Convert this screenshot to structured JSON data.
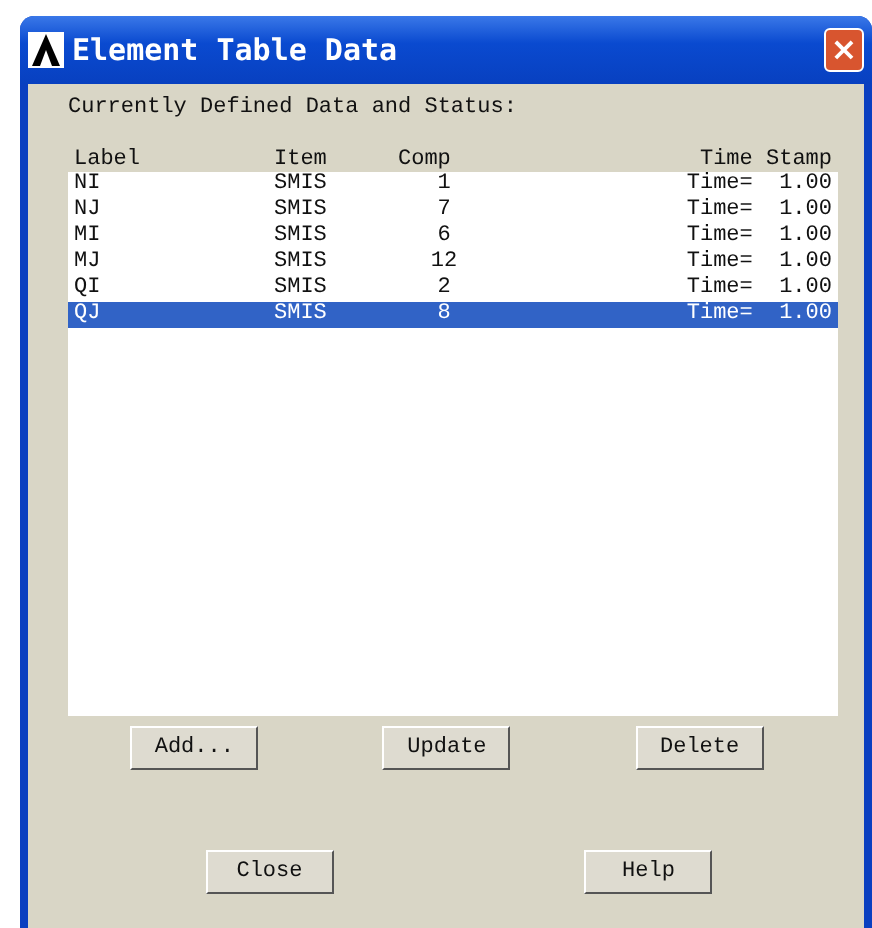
{
  "window": {
    "title": "Element Table Data",
    "close": "×"
  },
  "caption": "Currently Defined Data and Status:",
  "table": {
    "columns": [
      "Label",
      "Item",
      "Comp",
      "Time Stamp"
    ],
    "rows": [
      {
        "cells": [
          "NI",
          "SMIS",
          "1",
          "Time=  1.00"
        ],
        "selected": false
      },
      {
        "cells": [
          "NJ",
          "SMIS",
          "7",
          "Time=  1.00"
        ],
        "selected": false
      },
      {
        "cells": [
          "MI",
          "SMIS",
          "6",
          "Time=  1.00"
        ],
        "selected": false
      },
      {
        "cells": [
          "MJ",
          "SMIS",
          "12",
          "Time=  1.00"
        ],
        "selected": false
      },
      {
        "cells": [
          "QI",
          "SMIS",
          "2",
          "Time=  1.00"
        ],
        "selected": false
      },
      {
        "cells": [
          "QJ",
          "SMIS",
          "8",
          "Time=  1.00"
        ],
        "selected": true
      }
    ]
  },
  "actions": [
    "Add...",
    "Update",
    "Delete"
  ],
  "footer_buttons": [
    "Close",
    "Help"
  ]
}
